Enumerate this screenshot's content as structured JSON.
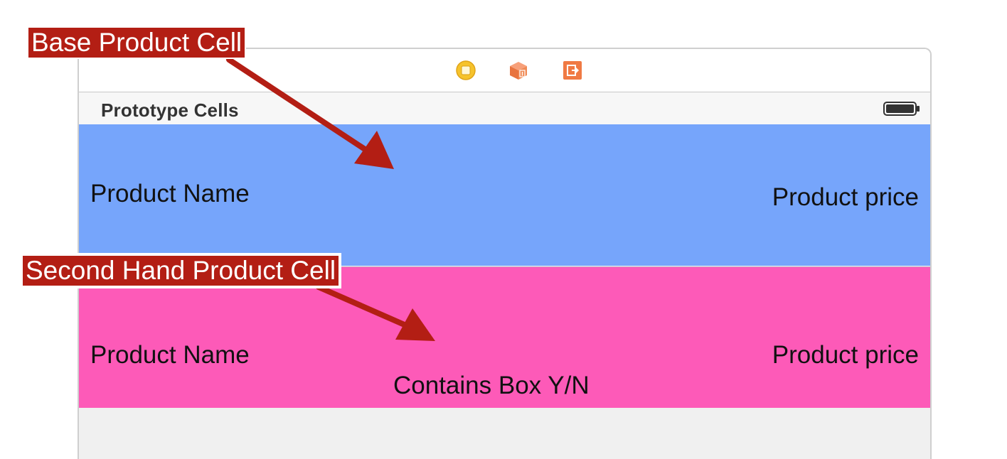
{
  "scene": {
    "dock_icons": [
      "view-controller-icon",
      "first-responder-icon",
      "exit-icon"
    ],
    "section_title": "Prototype Cells",
    "status_icon": "battery-icon"
  },
  "cells": {
    "base": {
      "name_label": "Product Name",
      "price_label": "Product price",
      "background": "#76a5fb"
    },
    "second_hand": {
      "name_label": "Product Name",
      "price_label": "Product price",
      "box_label": "Contains Box Y/N",
      "background": "#fd5ab8"
    }
  },
  "callouts": {
    "base": "Base Product Cell",
    "second_hand": "Second Hand Product Cell",
    "background": "#b31e14"
  }
}
